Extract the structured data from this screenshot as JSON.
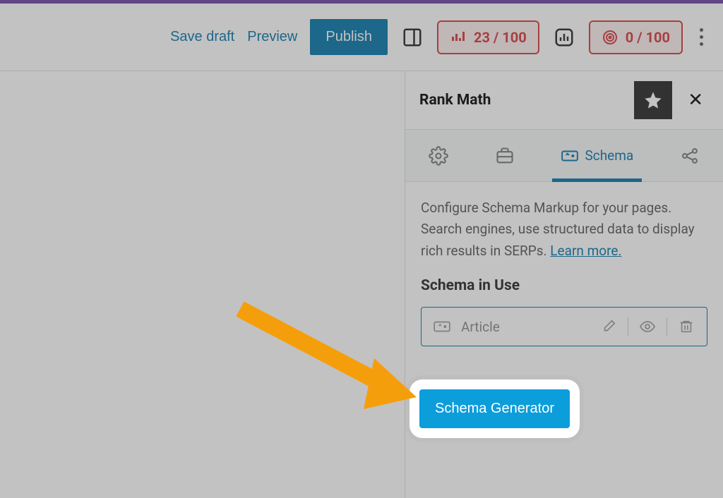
{
  "toolbar": {
    "save_draft": "Save draft",
    "preview": "Preview",
    "publish": "Publish",
    "score1": "23 / 100",
    "score2": "0 / 100"
  },
  "sidebar": {
    "title": "Rank Math",
    "tabs": {
      "schema_label": "Schema"
    },
    "desc_part1": "Configure Schema Markup for your pages. Search engines, use structured data to display rich results in SERPs. ",
    "learn_more": "Learn more.",
    "heading": "Schema in Use",
    "schema_item": "Article",
    "generator_label": "Schema Generator"
  }
}
